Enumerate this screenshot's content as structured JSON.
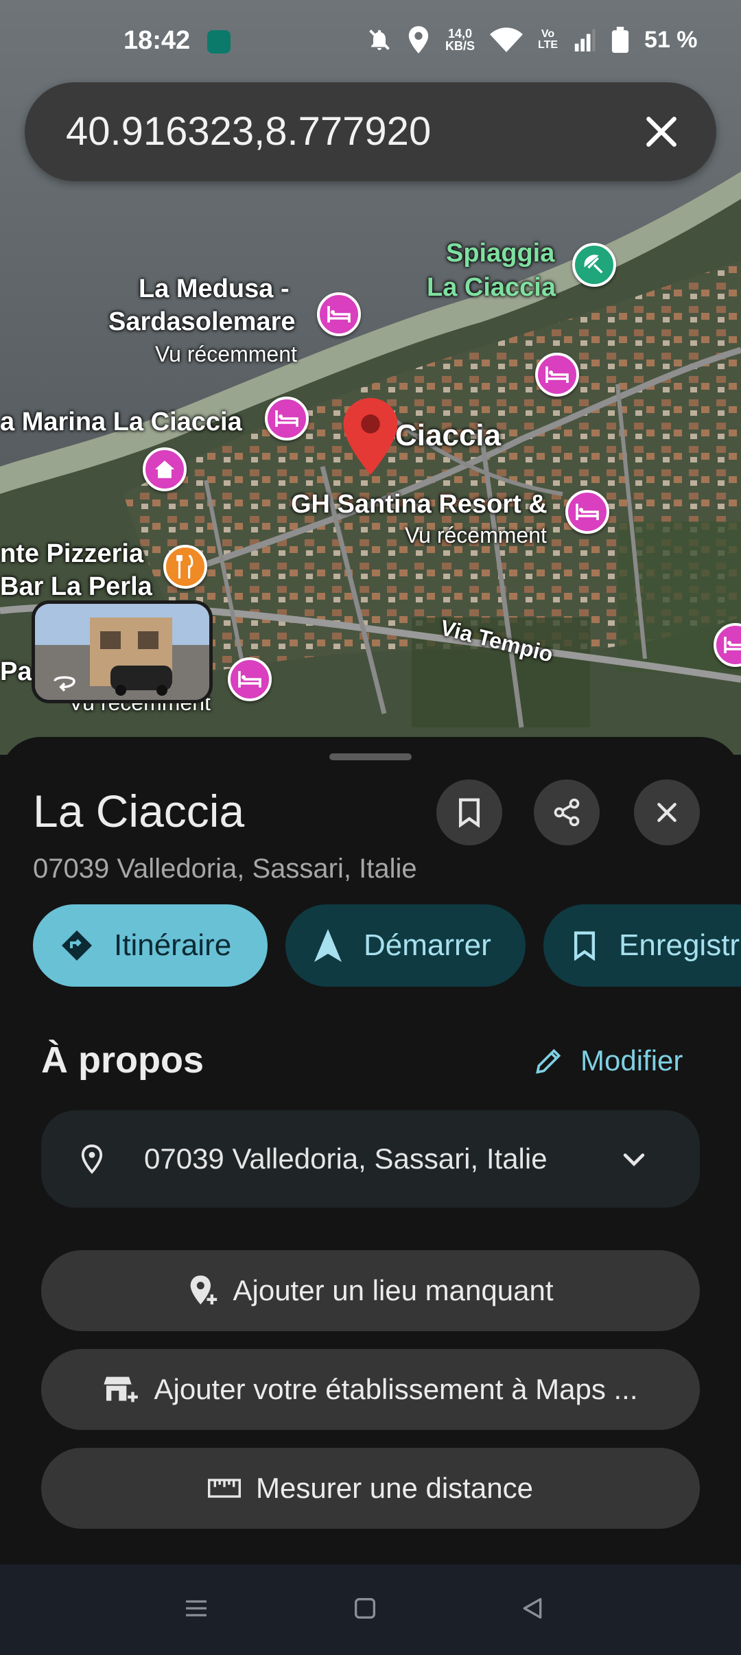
{
  "status": {
    "time": "18:42",
    "speed_top": "14,0",
    "speed_bottom": "KB/S",
    "volte_top": "Vo",
    "volte_bottom": "LTE",
    "battery": "51 %"
  },
  "search": {
    "value": "40.916323,8.777920"
  },
  "map": {
    "labels": {
      "beach": "Spiaggia",
      "beach_2": "La Ciaccia",
      "medusa_1": "La Medusa -",
      "medusa_2": "Sardasolemare",
      "recent": "Vu récemment",
      "marina": "a Marina La Ciaccia",
      "place": "Ciaccia",
      "resort": "GH Santina Resort &",
      "pizzeria_1": "nte Pizzeria",
      "pizzeria_2": "Bar La Perla",
      "road": "Via Tempio",
      "pa": "Pa",
      "recent_cut": "Vu récemment"
    }
  },
  "place": {
    "title": "La Ciaccia",
    "subtitle": "07039 Valledoria, Sassari, Italie"
  },
  "chips": {
    "directions": "Itinéraire",
    "start": "Démarrer",
    "save": "Enregistrer"
  },
  "about": {
    "title": "À propos",
    "edit": "Modifier",
    "address": "07039 Valledoria, Sassari, Italie"
  },
  "actions": {
    "add_place": "Ajouter un lieu manquant",
    "add_business": "Ajouter votre établissement à Maps ...",
    "measure": "Mesurer une distance"
  },
  "colors": {
    "accent": "#69c1d6",
    "pin": "#e53935",
    "hotel": "#d93fbf"
  }
}
